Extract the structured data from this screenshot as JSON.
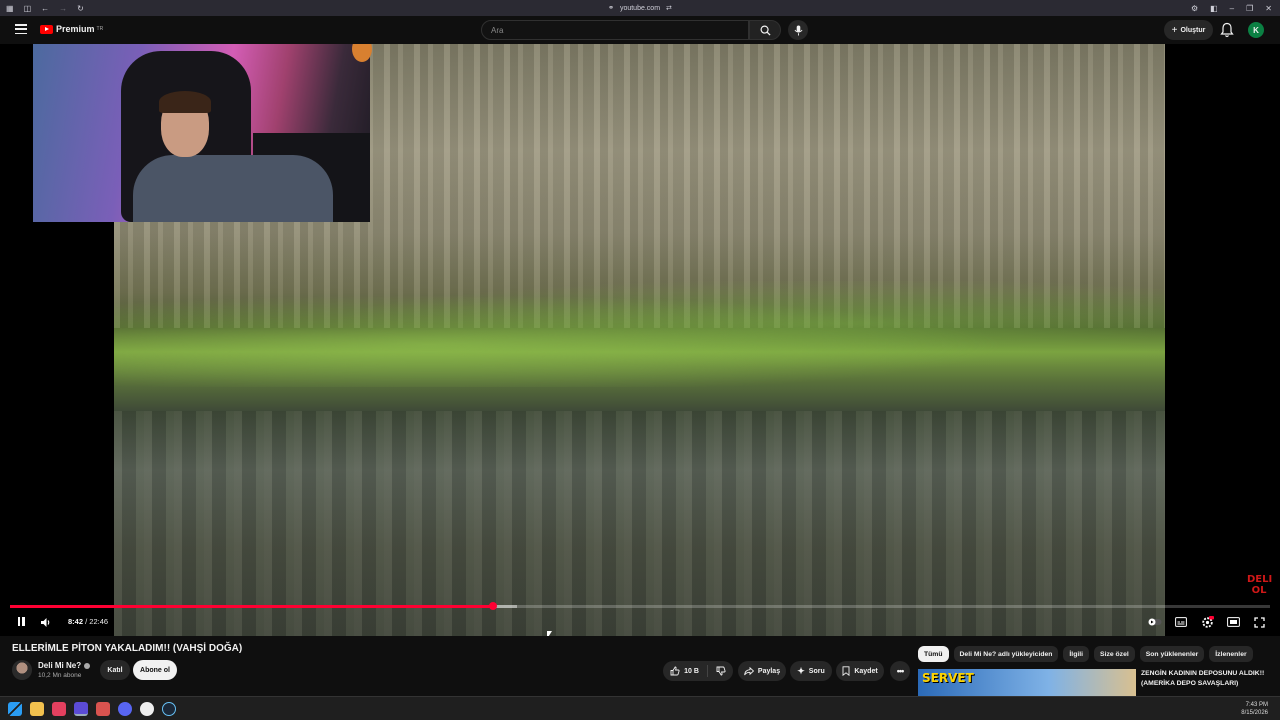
{
  "browser": {
    "url": "youtube.com"
  },
  "header": {
    "logo_text": "Premium",
    "logo_sup": "TR",
    "search_placeholder": "Ara",
    "create_label": "Oluştur",
    "avatar_letter": "K"
  },
  "player": {
    "current_time": "8:42",
    "duration": "22:46",
    "time_separator": " / ",
    "progress_fraction": 0.383,
    "buffer_fraction": 0.402,
    "watermark": "DELI OL"
  },
  "video": {
    "title": "ELLERİMLE PİTON YAKALADIM!! (VAHŞİ DOĞA)",
    "channel_name": "Deli Mi Ne?",
    "subscribers": "10,2 Mn abone",
    "join_label": "Katıl",
    "subscribe_label": "Abone ol",
    "like_count": "10 B",
    "share_label": "Paylaş",
    "ask_label": "Soru",
    "save_label": "Kaydet"
  },
  "chips": [
    "Tümü",
    "Deli Mi Ne? adlı yükleyiciden",
    "İlgili",
    "Size özel",
    "Son yüklenenler",
    "İzlenenler"
  ],
  "recommendation": {
    "thumb_text": "SERVET",
    "title": "ZENGİN KADININ DEPOSUNU ALDIK!! (AMERİKA DEPO SAVAŞLARI)"
  },
  "taskbar": {
    "time": "7:43 PM",
    "date": "8/15/2026"
  },
  "colors": {
    "accent": "#ff0033",
    "avatar": "#0b8043"
  }
}
